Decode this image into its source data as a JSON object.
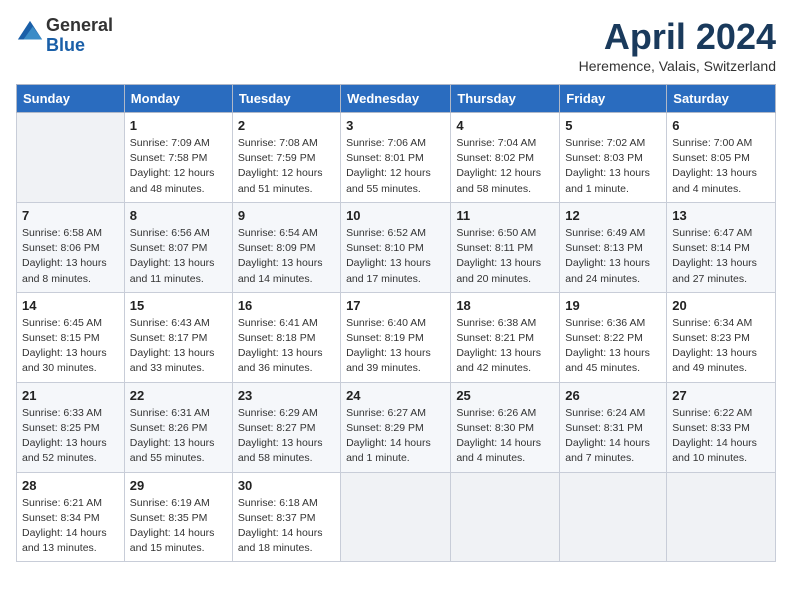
{
  "logo": {
    "general": "General",
    "blue": "Blue"
  },
  "header": {
    "title": "April 2024",
    "subtitle": "Heremence, Valais, Switzerland"
  },
  "weekdays": [
    "Sunday",
    "Monday",
    "Tuesday",
    "Wednesday",
    "Thursday",
    "Friday",
    "Saturday"
  ],
  "weeks": [
    [
      {
        "day": "",
        "detail": ""
      },
      {
        "day": "1",
        "detail": "Sunrise: 7:09 AM\nSunset: 7:58 PM\nDaylight: 12 hours\nand 48 minutes."
      },
      {
        "day": "2",
        "detail": "Sunrise: 7:08 AM\nSunset: 7:59 PM\nDaylight: 12 hours\nand 51 minutes."
      },
      {
        "day": "3",
        "detail": "Sunrise: 7:06 AM\nSunset: 8:01 PM\nDaylight: 12 hours\nand 55 minutes."
      },
      {
        "day": "4",
        "detail": "Sunrise: 7:04 AM\nSunset: 8:02 PM\nDaylight: 12 hours\nand 58 minutes."
      },
      {
        "day": "5",
        "detail": "Sunrise: 7:02 AM\nSunset: 8:03 PM\nDaylight: 13 hours\nand 1 minute."
      },
      {
        "day": "6",
        "detail": "Sunrise: 7:00 AM\nSunset: 8:05 PM\nDaylight: 13 hours\nand 4 minutes."
      }
    ],
    [
      {
        "day": "7",
        "detail": "Sunrise: 6:58 AM\nSunset: 8:06 PM\nDaylight: 13 hours\nand 8 minutes."
      },
      {
        "day": "8",
        "detail": "Sunrise: 6:56 AM\nSunset: 8:07 PM\nDaylight: 13 hours\nand 11 minutes."
      },
      {
        "day": "9",
        "detail": "Sunrise: 6:54 AM\nSunset: 8:09 PM\nDaylight: 13 hours\nand 14 minutes."
      },
      {
        "day": "10",
        "detail": "Sunrise: 6:52 AM\nSunset: 8:10 PM\nDaylight: 13 hours\nand 17 minutes."
      },
      {
        "day": "11",
        "detail": "Sunrise: 6:50 AM\nSunset: 8:11 PM\nDaylight: 13 hours\nand 20 minutes."
      },
      {
        "day": "12",
        "detail": "Sunrise: 6:49 AM\nSunset: 8:13 PM\nDaylight: 13 hours\nand 24 minutes."
      },
      {
        "day": "13",
        "detail": "Sunrise: 6:47 AM\nSunset: 8:14 PM\nDaylight: 13 hours\nand 27 minutes."
      }
    ],
    [
      {
        "day": "14",
        "detail": "Sunrise: 6:45 AM\nSunset: 8:15 PM\nDaylight: 13 hours\nand 30 minutes."
      },
      {
        "day": "15",
        "detail": "Sunrise: 6:43 AM\nSunset: 8:17 PM\nDaylight: 13 hours\nand 33 minutes."
      },
      {
        "day": "16",
        "detail": "Sunrise: 6:41 AM\nSunset: 8:18 PM\nDaylight: 13 hours\nand 36 minutes."
      },
      {
        "day": "17",
        "detail": "Sunrise: 6:40 AM\nSunset: 8:19 PM\nDaylight: 13 hours\nand 39 minutes."
      },
      {
        "day": "18",
        "detail": "Sunrise: 6:38 AM\nSunset: 8:21 PM\nDaylight: 13 hours\nand 42 minutes."
      },
      {
        "day": "19",
        "detail": "Sunrise: 6:36 AM\nSunset: 8:22 PM\nDaylight: 13 hours\nand 45 minutes."
      },
      {
        "day": "20",
        "detail": "Sunrise: 6:34 AM\nSunset: 8:23 PM\nDaylight: 13 hours\nand 49 minutes."
      }
    ],
    [
      {
        "day": "21",
        "detail": "Sunrise: 6:33 AM\nSunset: 8:25 PM\nDaylight: 13 hours\nand 52 minutes."
      },
      {
        "day": "22",
        "detail": "Sunrise: 6:31 AM\nSunset: 8:26 PM\nDaylight: 13 hours\nand 55 minutes."
      },
      {
        "day": "23",
        "detail": "Sunrise: 6:29 AM\nSunset: 8:27 PM\nDaylight: 13 hours\nand 58 minutes."
      },
      {
        "day": "24",
        "detail": "Sunrise: 6:27 AM\nSunset: 8:29 PM\nDaylight: 14 hours\nand 1 minute."
      },
      {
        "day": "25",
        "detail": "Sunrise: 6:26 AM\nSunset: 8:30 PM\nDaylight: 14 hours\nand 4 minutes."
      },
      {
        "day": "26",
        "detail": "Sunrise: 6:24 AM\nSunset: 8:31 PM\nDaylight: 14 hours\nand 7 minutes."
      },
      {
        "day": "27",
        "detail": "Sunrise: 6:22 AM\nSunset: 8:33 PM\nDaylight: 14 hours\nand 10 minutes."
      }
    ],
    [
      {
        "day": "28",
        "detail": "Sunrise: 6:21 AM\nSunset: 8:34 PM\nDaylight: 14 hours\nand 13 minutes."
      },
      {
        "day": "29",
        "detail": "Sunrise: 6:19 AM\nSunset: 8:35 PM\nDaylight: 14 hours\nand 15 minutes."
      },
      {
        "day": "30",
        "detail": "Sunrise: 6:18 AM\nSunset: 8:37 PM\nDaylight: 14 hours\nand 18 minutes."
      },
      {
        "day": "",
        "detail": ""
      },
      {
        "day": "",
        "detail": ""
      },
      {
        "day": "",
        "detail": ""
      },
      {
        "day": "",
        "detail": ""
      }
    ]
  ]
}
